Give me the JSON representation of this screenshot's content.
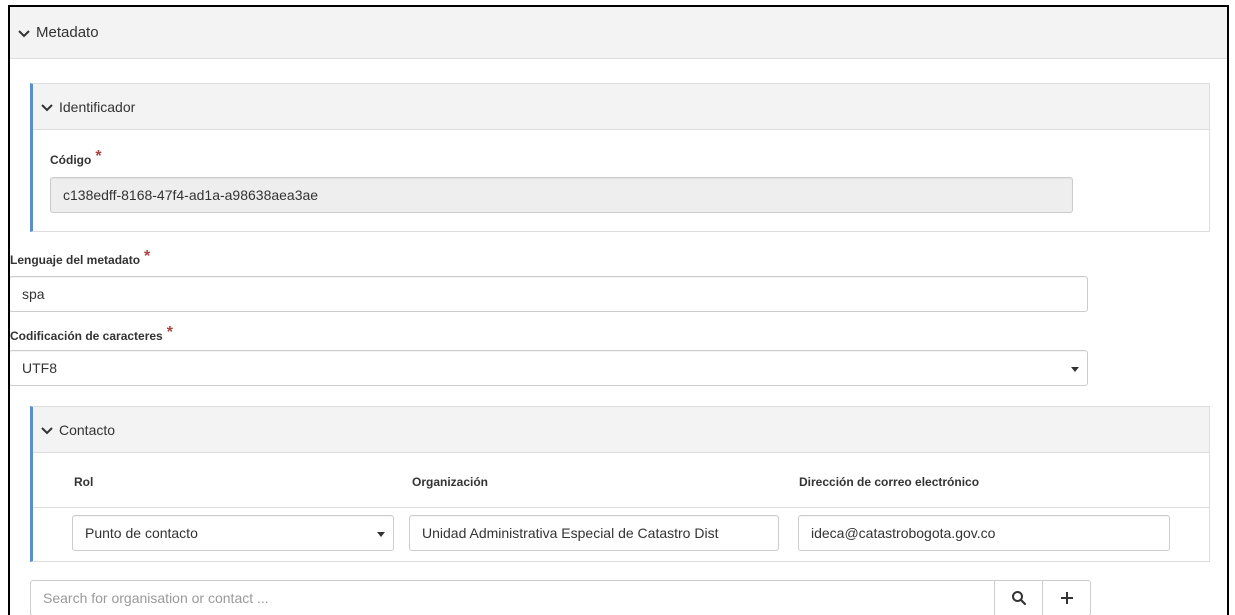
{
  "metadato": {
    "title": "Metadato"
  },
  "identificador": {
    "title": "Identificador",
    "codigo_label": "Código",
    "codigo_value": "c138edff-8168-47f4-ad1a-a98638aea3ae"
  },
  "lenguaje": {
    "label": "Lenguaje del metadato",
    "value": "spa"
  },
  "codificacion": {
    "label": "Codificación de caracteres",
    "value": "UTF8"
  },
  "contacto": {
    "title": "Contacto",
    "columns": [
      "Rol",
      "Organización",
      "Dirección de correo electrónico"
    ],
    "row": {
      "rol": "Punto de contacto",
      "organizacion": "Unidad Administrativa Especial de Catastro Dist",
      "email": "ideca@catastrobogota.gov.co"
    }
  },
  "search": {
    "placeholder": "Search for organisation or contact ..."
  },
  "required_marker": "*",
  "icons": {
    "search": "search-icon",
    "add": "plus-icon",
    "expand": "chevron-down-icon"
  },
  "colors": {
    "accent_border": "#5b8fc7",
    "required": "#a94442",
    "header_bg": "#f3f3f3"
  }
}
